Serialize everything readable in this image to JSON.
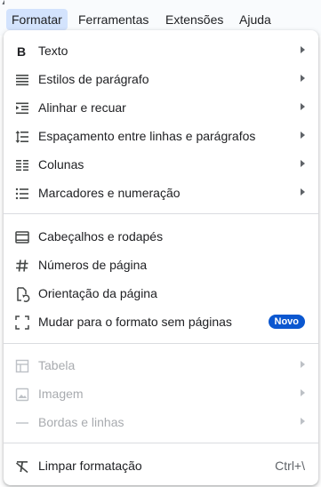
{
  "menubar": {
    "items": [
      "Formatar",
      "Ferramentas",
      "Extensões",
      "Ajuda"
    ],
    "active": "Formatar"
  },
  "menu": {
    "group1": [
      {
        "label": "Texto",
        "icon": "bold-icon",
        "submenu": true
      },
      {
        "label": "Estilos de parágrafo",
        "icon": "paragraph-styles-icon",
        "submenu": true
      },
      {
        "label": "Alinhar e recuar",
        "icon": "indent-icon",
        "submenu": true
      },
      {
        "label": "Espaçamento entre linhas e parágrafos",
        "icon": "line-spacing-icon",
        "submenu": true
      },
      {
        "label": "Colunas",
        "icon": "columns-icon",
        "submenu": true
      },
      {
        "label": "Marcadores e numeração",
        "icon": "bulleted-list-icon",
        "submenu": true
      }
    ],
    "group2": [
      {
        "label": "Cabeçalhos e rodapés",
        "icon": "header-footer-icon"
      },
      {
        "label": "Números de página",
        "icon": "hash-icon"
      },
      {
        "label": "Orientação da página",
        "icon": "page-orientation-icon"
      },
      {
        "label": "Mudar para o formato sem páginas",
        "icon": "pageless-icon",
        "badge": "Novo"
      }
    ],
    "group3": [
      {
        "label": "Tabela",
        "icon": "table-icon",
        "submenu": true,
        "disabled": true
      },
      {
        "label": "Imagem",
        "icon": "image-icon",
        "submenu": true,
        "disabled": true
      },
      {
        "label": "Bordas e linhas",
        "icon": "horizontal-line-icon",
        "submenu": true,
        "disabled": true
      }
    ],
    "group4": [
      {
        "label": "Limpar formatação",
        "icon": "clear-formatting-icon",
        "shortcut": "Ctrl+\\"
      }
    ]
  },
  "colors": {
    "accent": "#0b57d0",
    "active_menu_bg": "#d3e3fd",
    "disabled_text": "#a8abaf",
    "icon": "#444746"
  }
}
